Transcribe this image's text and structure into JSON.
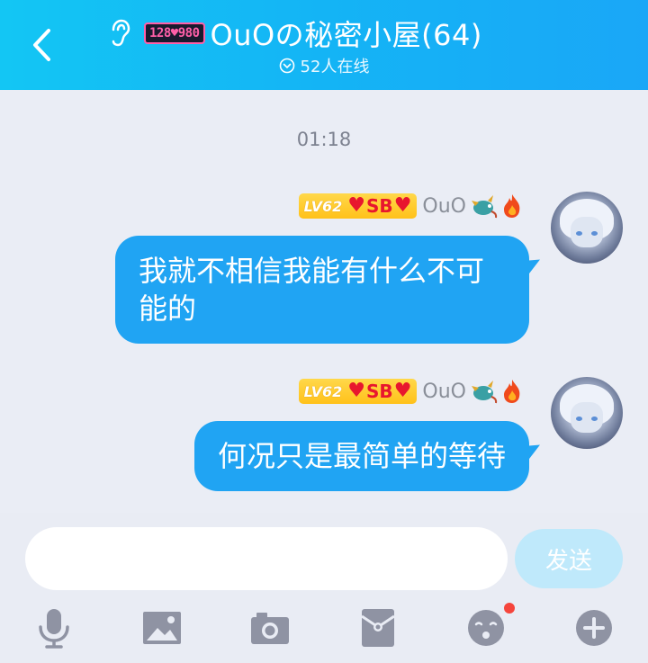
{
  "header": {
    "group_badge": "128♥980",
    "title": "OuOの秘密小屋(64)",
    "online_text": "52人在线"
  },
  "chat": {
    "timestamp": "01:18",
    "messages": [
      {
        "level": "LV62",
        "tag": "SB",
        "sender": "OuO",
        "text_line1": "我就不相信我能有什么不可",
        "text_line2": "能的"
      },
      {
        "level": "LV62",
        "tag": "SB",
        "sender": "OuO",
        "text_line1": "何况只是最简单的等待"
      }
    ]
  },
  "input": {
    "placeholder": "",
    "send_label": "发送"
  },
  "colors": {
    "header_start": "#13c6f4",
    "header_end": "#1aa7f7",
    "bubble": "#20a4f3",
    "send_button": "#bfe9fb",
    "level_badge": "#ffc11a",
    "heart": "#e8162e",
    "notification_dot": "#f5453c",
    "toolbar_icon": "#8f93a3"
  },
  "icons": {
    "back": "chevron-left-icon",
    "ear": "ear-icon",
    "online": "chevron-circle-down-icon",
    "toolbar": [
      "microphone-icon",
      "image-icon",
      "camera-icon",
      "red-packet-icon",
      "emoji-icon",
      "plus-icon"
    ]
  }
}
